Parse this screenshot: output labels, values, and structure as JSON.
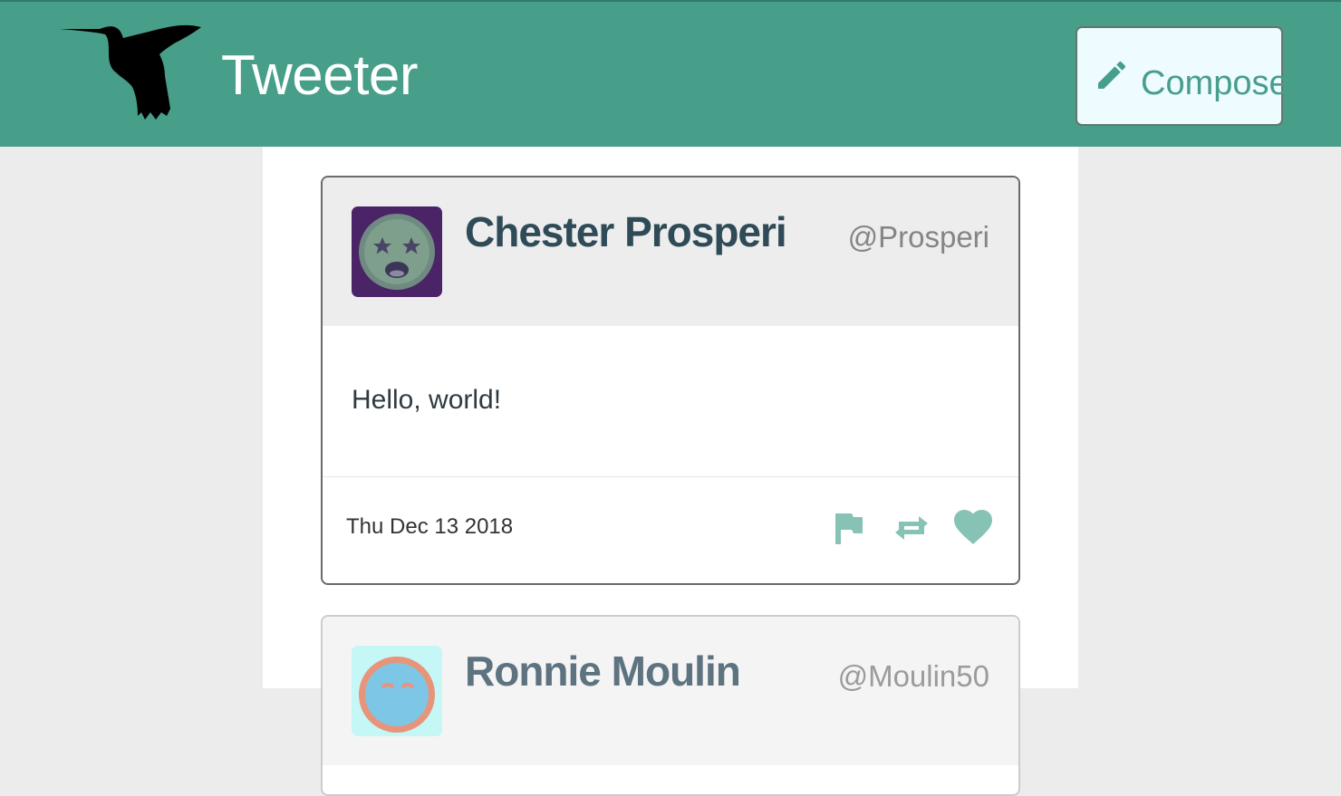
{
  "nav": {
    "brand": "Tweeter",
    "logo_icon": "hummingbird-icon",
    "compose_label": "Compose",
    "compose_icon": "pencil-icon",
    "colors": {
      "bar": "#479e89",
      "compose_bg": "#eefbff"
    }
  },
  "tweets": [
    {
      "name": "Chester Prosperi",
      "handle": "@Prosperi",
      "avatar_icon": "star-eyes-face-avatar",
      "content": "Hello, world!",
      "date": "Thu Dec 13 2018",
      "actions": [
        "flag-icon",
        "retweet-icon",
        "heart-icon"
      ]
    },
    {
      "name": "Ronnie Moulin",
      "handle": "@Moulin50",
      "avatar_icon": "face-avatar"
    }
  ],
  "colors": {
    "accent": "#479e89",
    "action_icons": "#86c3b5",
    "name": "#2e4b57"
  }
}
